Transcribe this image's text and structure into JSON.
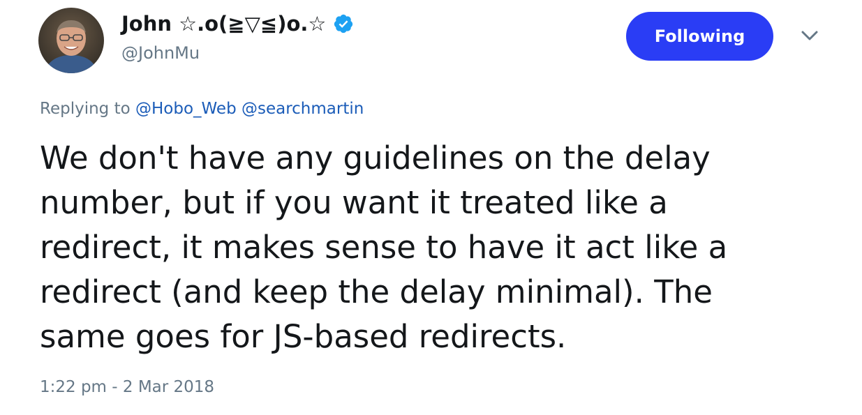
{
  "author": {
    "display_name": "John ☆.o(≧▽≦)o.☆",
    "handle": "@JohnMu",
    "avatar_icon": "person-avatar-icon",
    "verified_icon": "verified-badge-icon"
  },
  "actions": {
    "follow_label": "Following",
    "menu_icon": "chevron-down-icon"
  },
  "reply": {
    "prefix": "Replying to",
    "mentions": [
      "@Hobo_Web",
      "@searchmartin"
    ]
  },
  "tweet": {
    "lines": [
      "We don't have any guidelines on the delay",
      "number, but if you want it treated like a",
      "redirect, it makes sense to have it act like a",
      "redirect (and keep the delay minimal). The",
      "same goes for JS-based redirects."
    ]
  },
  "timestamp": "1:22 pm - 2 Mar 2018",
  "colors": {
    "follow_button": "#2a3df5",
    "link": "#1b5cb8",
    "secondary_text": "#657786",
    "verified": "#1da1f2"
  }
}
